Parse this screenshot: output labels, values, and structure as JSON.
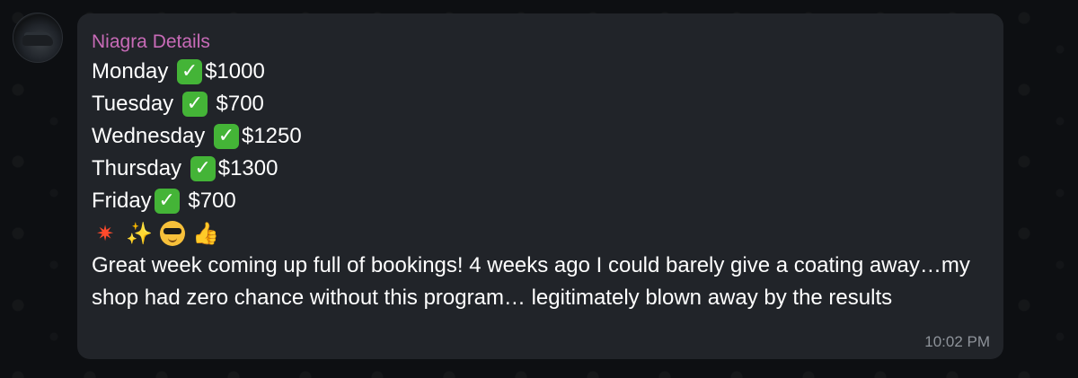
{
  "chat": {
    "sender_name": "Niagra Details",
    "schedule": [
      {
        "day": "Monday ",
        "amount": "$1000"
      },
      {
        "day": "Tuesday ",
        "amount": " $700"
      },
      {
        "day": "Wednesday ",
        "amount": "$1250"
      },
      {
        "day": "Thursday ",
        "amount": "$1300"
      },
      {
        "day": "Friday",
        "amount": " $700"
      }
    ],
    "check_icon": "white-check-mark-emoji",
    "check_glyph": "✓",
    "emojis": [
      {
        "name": "collision-emoji",
        "glyph": "✷"
      },
      {
        "name": "sparkles-emoji",
        "glyph": "✨"
      },
      {
        "name": "smiling-face-with-sunglasses-emoji",
        "glyph": ""
      },
      {
        "name": "thumbs-up-emoji",
        "glyph": "👍"
      }
    ],
    "message": "Great week coming up full of bookings! 4 weeks ago I could barely give a coating away…my shop had zero chance without this program… legitimately blown away by the results",
    "time": "10:02 PM"
  },
  "colors": {
    "background": "#0d0f12",
    "bubble": "#212429",
    "sender_name": "#c86bb7",
    "check_green": "#44b437",
    "timestamp": "#8e939a"
  }
}
